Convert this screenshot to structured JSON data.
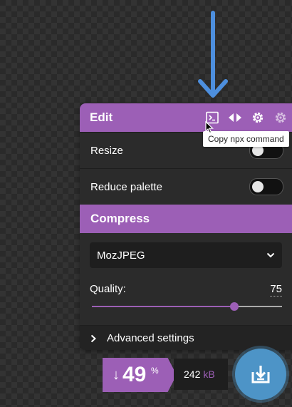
{
  "edit": {
    "title": "Edit",
    "tooltip": "Copy npx command",
    "icons": [
      "terminal-icon",
      "flip-horizontal-icon",
      "gear-icon",
      "gear-settings-icon"
    ]
  },
  "options": [
    {
      "label": "Resize",
      "enabled": false
    },
    {
      "label": "Reduce palette",
      "enabled": false
    }
  ],
  "compress": {
    "title": "Compress",
    "codec": "MozJPEG",
    "quality_label": "Quality:",
    "quality_value": "75",
    "quality_fraction": 0.75,
    "advanced_label": "Advanced settings"
  },
  "result": {
    "savings_arrow": "↓",
    "savings_value": "49",
    "savings_unit": "%",
    "size_value": "242",
    "size_unit": "kB"
  },
  "colors": {
    "accent": "#9c5fb6",
    "download": "#4d94c7",
    "annotation_arrow": "#4d8fde"
  }
}
